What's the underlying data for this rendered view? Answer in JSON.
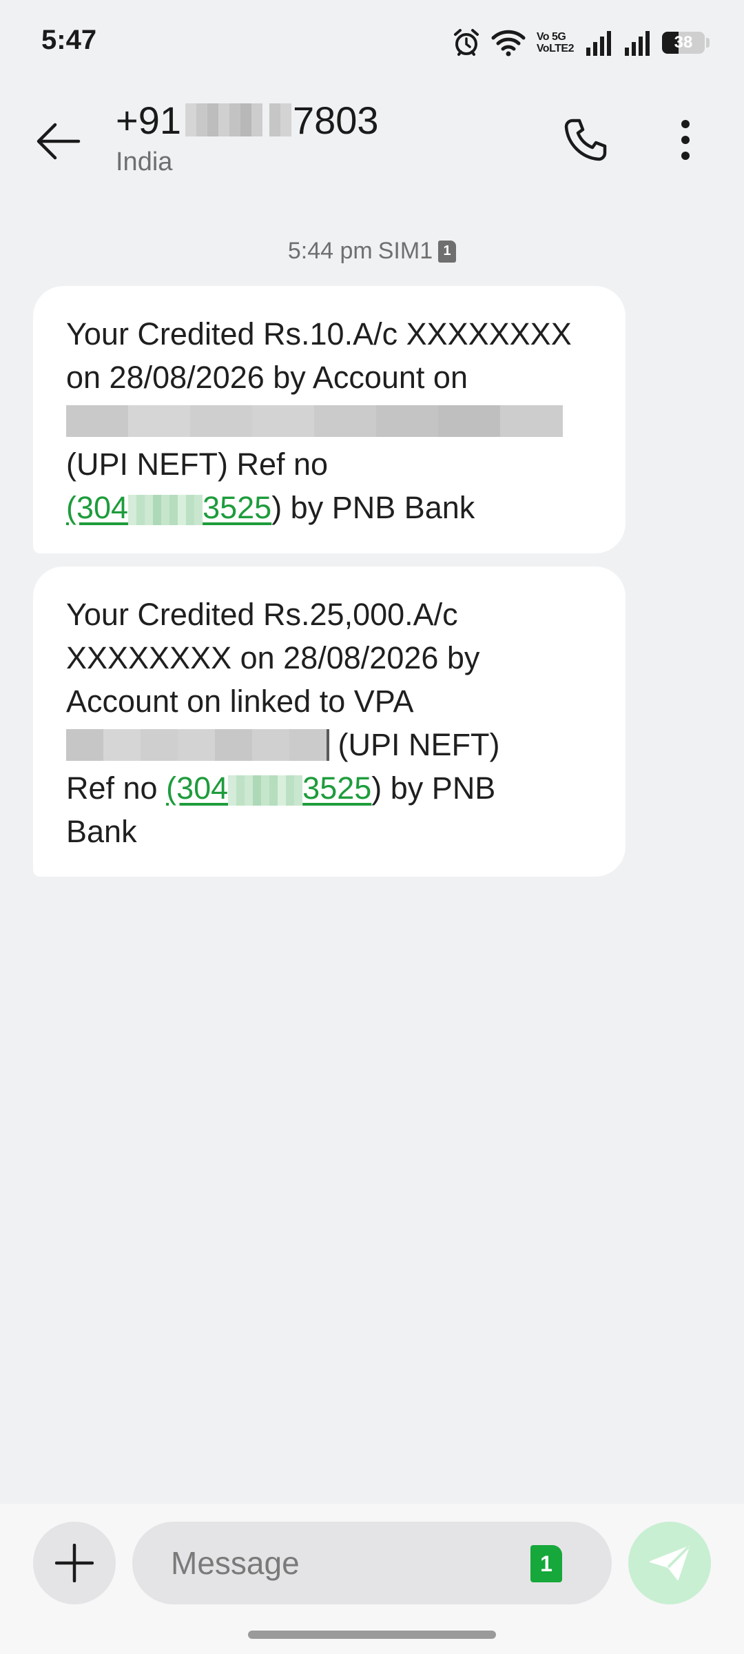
{
  "status_bar": {
    "time": "5:47",
    "icons": [
      "alarm-icon",
      "wifi-icon",
      "volte-icon",
      "signal-sim1-icon",
      "signal-sim2-icon",
      "battery-icon"
    ],
    "volte_line1": "Vo 5G",
    "volte_line2": "VoLTE2",
    "battery_percent": "38",
    "battery_level": 0.38
  },
  "header": {
    "back_icon": "arrow-left-icon",
    "contact_prefix": "+91",
    "contact_suffix": "7803",
    "contact_region": "India",
    "call_icon": "phone-icon",
    "more_icon": "more-vertical-icon"
  },
  "conversation": {
    "timestamp": "5:44 pm",
    "sim_label": "SIM1",
    "sim_number": "1",
    "messages": [
      {
        "line1": "Your Credited Rs.10.A/c XXXXXXXX",
        "line2": "on 28/08/2026 by Account on",
        "line3": "(UPI NEFT) Ref no",
        "ref_open": "(304",
        "ref_close": "3525",
        "tail": ") by PNB Bank"
      },
      {
        "line1": "Your Credited Rs.25,000.A/c",
        "line2": "XXXXXXXX on 28/08/2026 by",
        "line3": "Account on linked to VPA",
        "after_vpa": " (UPI NEFT)",
        "ref_prefix": "Ref no ",
        "ref_open": "(304",
        "ref_close": "3525",
        "tail": ") by PNB",
        "line6": "Bank"
      }
    ]
  },
  "composer": {
    "add_icon": "plus-icon",
    "placeholder": "Message",
    "sim_number": "1",
    "send_icon": "send-icon"
  },
  "colors": {
    "background": "#f0f1f3",
    "bubble": "#ffffff",
    "link_green": "#1e9c3c",
    "sim_green": "#16a83a",
    "send_disabled": "#c8efd2"
  }
}
